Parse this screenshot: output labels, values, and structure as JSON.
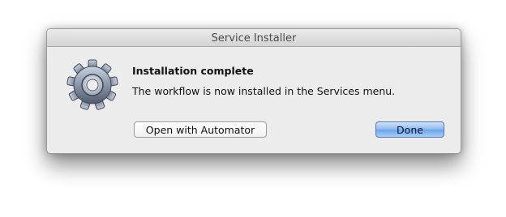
{
  "window": {
    "title": "Service Installer"
  },
  "dialog": {
    "icon": "gear-icon",
    "heading": "Installation complete",
    "message": "The workflow is now installed in the Services menu."
  },
  "buttons": {
    "secondary_label": "Open with Automator",
    "primary_label": "Done"
  },
  "colors": {
    "primary_button": "#8db8ef",
    "window_background": "#ececec"
  }
}
